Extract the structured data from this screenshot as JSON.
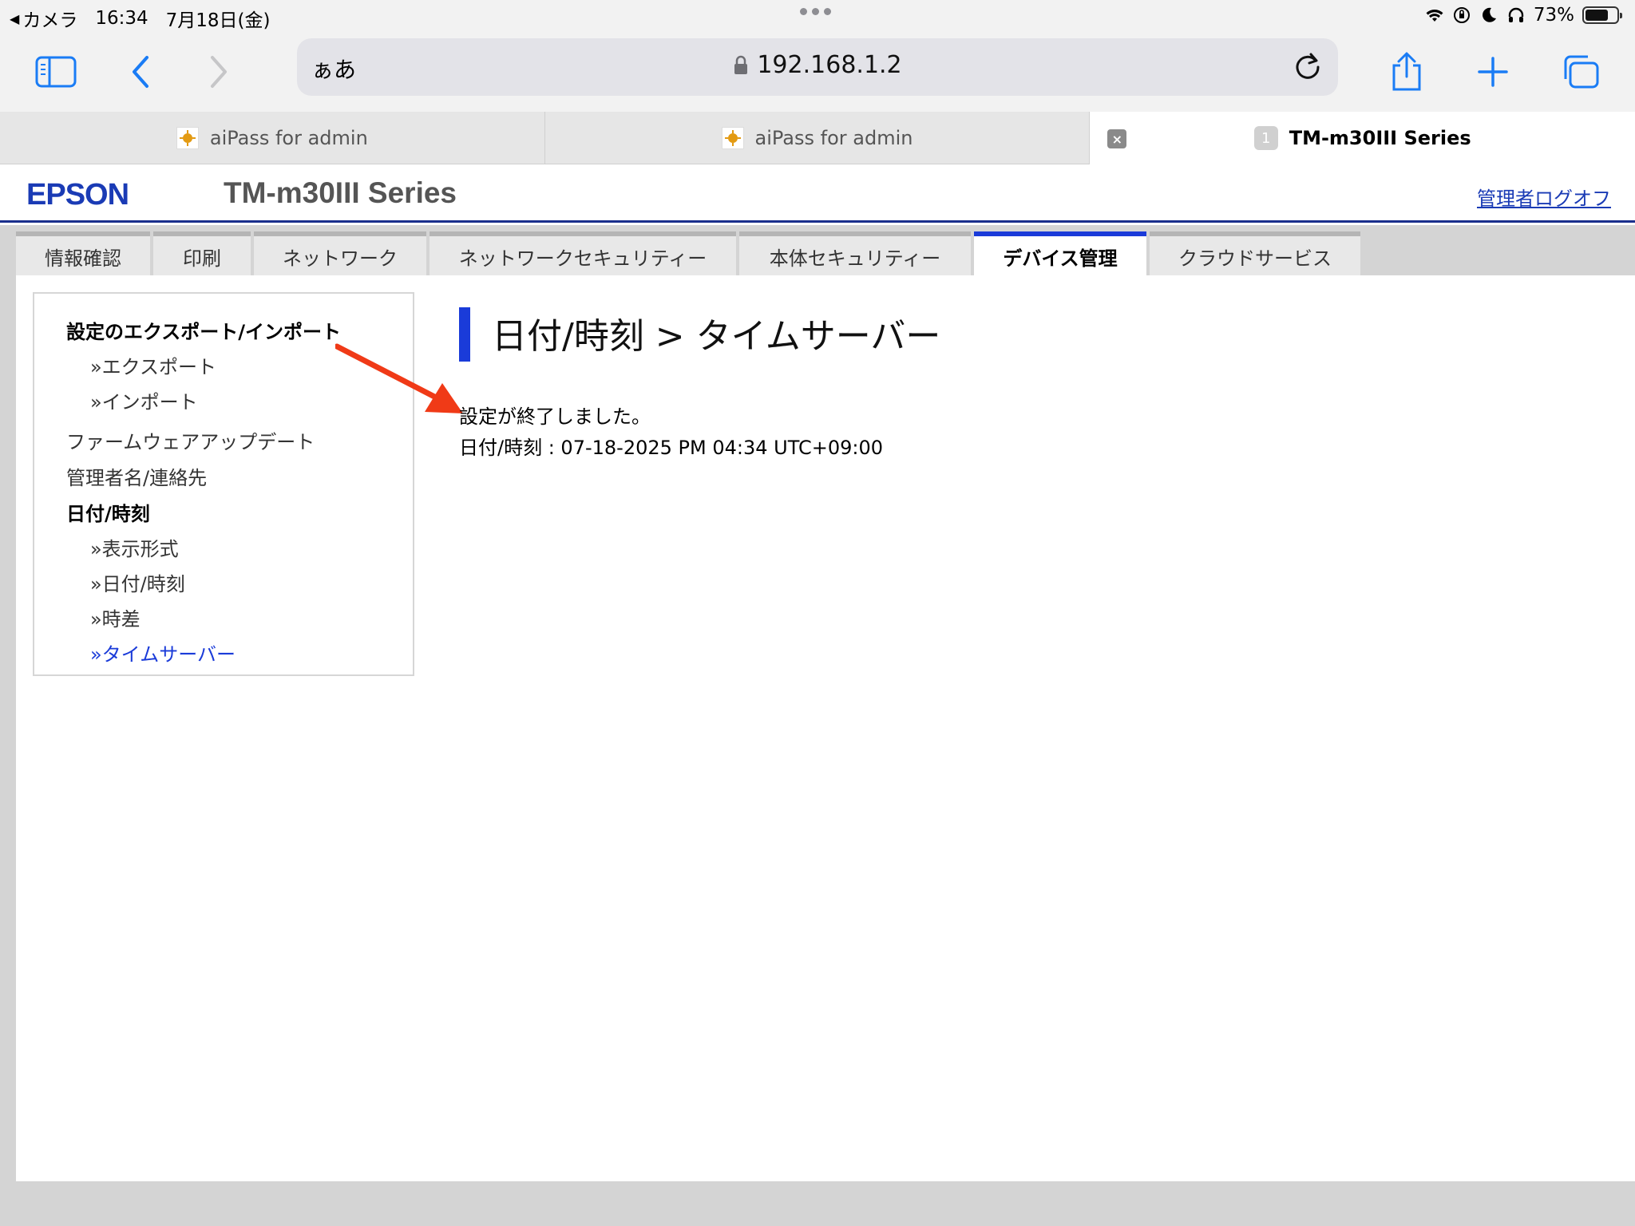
{
  "status_bar": {
    "back_app": "カメラ",
    "time": "16:34",
    "date": "7月18日(金)",
    "battery": "73%",
    "battery_level": 0.73
  },
  "browser": {
    "aa_label": "ぁあ",
    "url": "192.168.1.2",
    "tabs": [
      {
        "title": "aiPass for admin"
      },
      {
        "title": "aiPass for admin"
      },
      {
        "title": "TM-m30III Series",
        "badge": "1"
      }
    ],
    "tab_close_glyph": "×"
  },
  "header": {
    "logo": "EPSON",
    "product": "TM-m30III Series",
    "logoff": "管理者ログオフ"
  },
  "nav": {
    "items": [
      {
        "label": "情報確認"
      },
      {
        "label": "印刷"
      },
      {
        "label": "ネットワーク"
      },
      {
        "label": "ネットワークセキュリティー"
      },
      {
        "label": "本体セキュリティー"
      },
      {
        "label": "デバイス管理"
      },
      {
        "label": "クラウドサービス"
      }
    ],
    "active_index": 5
  },
  "sidebar": {
    "export_import": "設定のエクスポート/インポート",
    "export": "»エクスポート",
    "import": "»インポート",
    "firmware": "ファームウェアアップデート",
    "admin_contact": "管理者名/連絡先",
    "datetime": "日付/時刻",
    "display_format": "»表示形式",
    "datetime_sub": "»日付/時刻",
    "time_diff": "»時差",
    "time_server": "»タイムサーバー"
  },
  "main": {
    "title": "日付/時刻 > タイムサーバー",
    "message": "設定が終了しました。",
    "datetime_line": "日付/時刻 : 07-18-2025 PM 04:34 UTC+09:00"
  },
  "colors": {
    "accent": "#1a3bd9",
    "header_rule": "#1a2e8c",
    "annotation_arrow": "#f03a17"
  }
}
